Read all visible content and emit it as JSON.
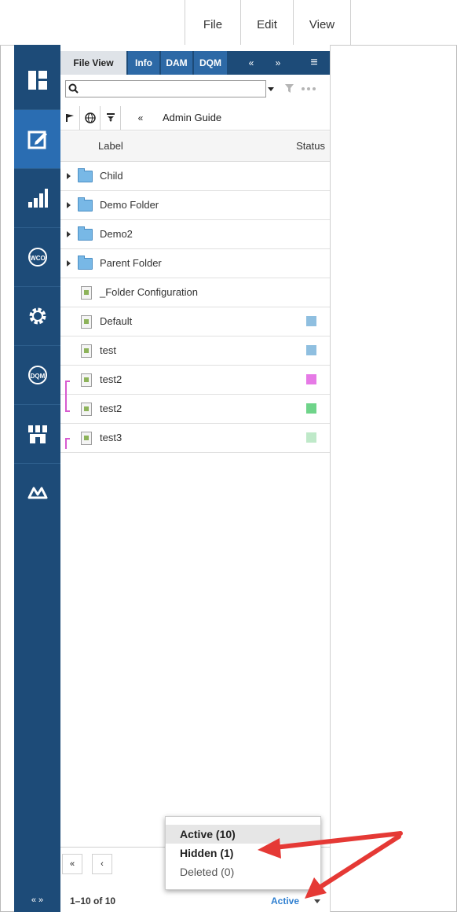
{
  "menu": {
    "items": [
      "File",
      "Edit",
      "View"
    ]
  },
  "rail": {
    "items": [
      {
        "icon": "dashboard-icon"
      },
      {
        "icon": "edit-icon",
        "active": true
      },
      {
        "icon": "analytics-icon"
      },
      {
        "icon": "wco-icon",
        "text": "WCO"
      },
      {
        "icon": "settings-icon"
      },
      {
        "icon": "dqm-icon",
        "text": "DQM"
      },
      {
        "icon": "store-icon"
      },
      {
        "icon": "infinity-icon"
      }
    ],
    "collapse_label": "« »"
  },
  "panel": {
    "tabs": [
      {
        "label": "File View",
        "active": true
      },
      {
        "label": "Info"
      },
      {
        "label": "DAM"
      },
      {
        "label": "DQM"
      }
    ],
    "tab_icons": [
      "«",
      "»",
      "≡"
    ],
    "search": {
      "value": "",
      "icon": "search-icon"
    },
    "toolbar": {
      "icons": [
        "flag-icon",
        "globe-icon",
        "filter-down-icon",
        "rewind-icon"
      ],
      "breadcrumb": "Admin Guide"
    },
    "columns": {
      "label": "Label",
      "status": "Status"
    },
    "rows": [
      {
        "type": "folder",
        "label": "Child",
        "expandable": true
      },
      {
        "type": "folder",
        "label": "Demo Folder",
        "expandable": true
      },
      {
        "type": "folder",
        "label": "Demo2",
        "expandable": true
      },
      {
        "type": "folder",
        "label": "Parent Folder",
        "expandable": true
      },
      {
        "type": "file",
        "label": "_Folder Configuration"
      },
      {
        "type": "file",
        "label": "Default",
        "status_color": "#8fbfe0"
      },
      {
        "type": "file",
        "label": "test",
        "status_color": "#8fbfe0"
      },
      {
        "type": "file",
        "label": "test2",
        "status_color": "#e67ae6"
      },
      {
        "type": "file",
        "label": "test2",
        "status_color": "#6fd48a"
      },
      {
        "type": "file",
        "label": "test3",
        "status_color": "#bfe9c9"
      }
    ],
    "pager": {
      "first": "«",
      "prev": "‹"
    },
    "footer": {
      "count": "1–10 of 10",
      "filter_value": "Active"
    }
  },
  "dropdown": {
    "options": [
      {
        "label": "Active (10)",
        "bold": true,
        "highlighted": true
      },
      {
        "label": "Hidden (1)",
        "bold": true
      },
      {
        "label": "Deleted (0)",
        "bold": false
      }
    ]
  },
  "colors": {
    "rail": "#1d4b78",
    "rail_active": "#2a6db2",
    "tab": "#2d69a6",
    "arrow": "#e53935",
    "link": "#2f7fd0"
  }
}
